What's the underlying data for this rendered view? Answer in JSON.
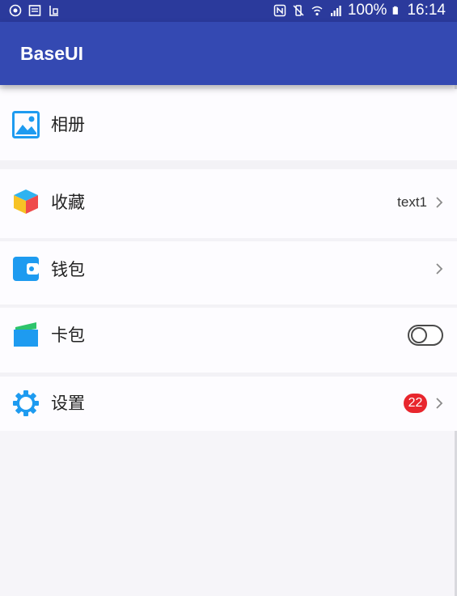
{
  "status_bar": {
    "battery": "100%",
    "time": "16:14"
  },
  "app_bar": {
    "title": "BaseUI"
  },
  "list": {
    "items": [
      {
        "icon": "photo-album-icon",
        "label": "相册"
      },
      {
        "icon": "cube-favorites-icon",
        "label": "收藏",
        "value": "text1",
        "chevron": true
      },
      {
        "icon": "wallet-icon",
        "label": "钱包",
        "chevron": true
      },
      {
        "icon": "card-wallet-icon",
        "label": "卡包",
        "toggle": false
      },
      {
        "icon": "settings-gear-icon",
        "label": "设置",
        "badge": "22",
        "chevron": true
      }
    ]
  },
  "colors": {
    "status_bar": "#2b3a9c",
    "app_bar": "#3449b2",
    "icon_blue": "#1e9bf0",
    "badge_red": "#e8262d"
  }
}
